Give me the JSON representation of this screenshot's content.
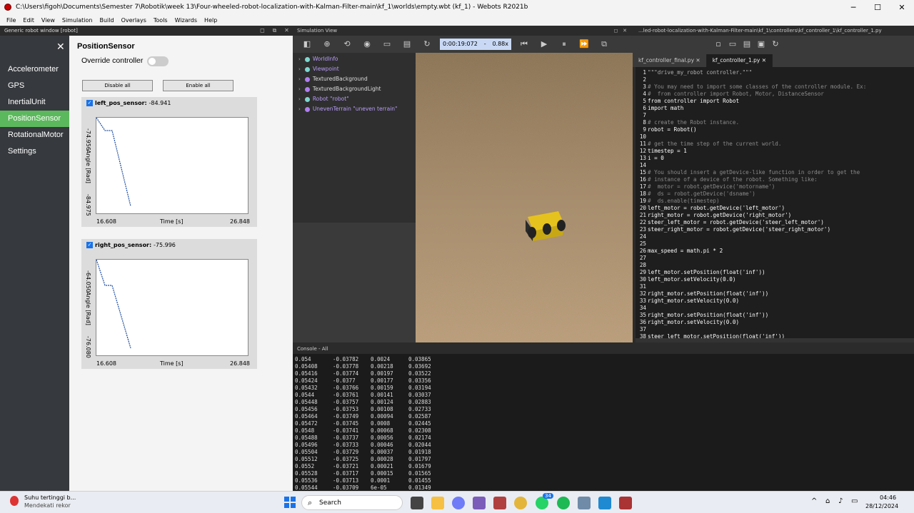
{
  "window": {
    "title": "C:\\Users\\figoh\\Documents\\Semester 7\\Robotik\\week 13\\Four-wheeled-robot-localization-with-Kalman-Filter-main\\kf_1\\worlds\\empty.wbt (kf_1) - Webots R2021b",
    "minimize": "─",
    "maximize": "☐",
    "close": "✕"
  },
  "menu": [
    "File",
    "Edit",
    "View",
    "Simulation",
    "Build",
    "Overlays",
    "Tools",
    "Wizards",
    "Help"
  ],
  "robot_window": {
    "title": "Generic robot window [robot]",
    "close": "✕",
    "sidebar": [
      "Accelerometer",
      "GPS",
      "InertialUnit",
      "PositionSensor",
      "RotationalMotor",
      "Settings"
    ],
    "active": "PositionSensor",
    "heading": "PositionSensor",
    "override": "Override controller",
    "disable_all": "Disable all",
    "enable_all": "Enable all",
    "plots": [
      {
        "label": "left_pos_sensor:",
        "value": "-84.941",
        "ymax": "-74.956",
        "ymin": "-84.975",
        "ylabel": "Angle [Rad]",
        "xmin": "16.608",
        "xmax": "26.848",
        "xlabel": "Time [s]"
      },
      {
        "label": "right_pos_sensor:",
        "value": "-75.996",
        "ymax": "-64.050",
        "ymin": "-76.080",
        "ylabel": "Angle [Rad]",
        "xmin": "16.608",
        "xmax": "26.848",
        "xlabel": "Time [s]"
      }
    ]
  },
  "sim": {
    "title": "Simulation View",
    "time": "0:00:19:072",
    "sep": "-",
    "speed": "0.88x",
    "scene_tree": [
      {
        "label": "WorldInfo",
        "color": "#7fd6d0"
      },
      {
        "label": "Viewpoint",
        "color": "#7fd6d0"
      },
      {
        "label": "TexturedBackground",
        "color": "#b07ef0"
      },
      {
        "label": "TexturedBackgroundLight",
        "color": "#b07ef0"
      },
      {
        "label": "Robot \"robot\"",
        "color": "#7fd6d0"
      },
      {
        "label": "UnevenTerrain \"uneven terrain\"",
        "color": "#b07ef0"
      }
    ]
  },
  "editor": {
    "title": "...led-robot-localization-with-Kalman-Filter-main\\kf_1\\controllers\\kf_controller_1\\kf_controller_1.py",
    "tabs": [
      "kf_controller_final.py",
      "kf_controller_1.py"
    ],
    "lines": [
      {
        "n": "1",
        "t": "\"\"\"drive_my_robot controller.\"\"\"",
        "c": "#b0b0b0"
      },
      {
        "n": "2",
        "t": "",
        "c": "#fff"
      },
      {
        "n": "3",
        "t": "# You may need to import some classes of the controller module. Ex:",
        "c": "#8a8a8a"
      },
      {
        "n": "4",
        "t": "#  from controller import Robot, Motor, DistanceSensor",
        "c": "#8a8a8a"
      },
      {
        "n": "5",
        "t": "from controller import Robot",
        "c": "#fff"
      },
      {
        "n": "6",
        "t": "import math",
        "c": "#fff"
      },
      {
        "n": "7",
        "t": "",
        "c": "#fff"
      },
      {
        "n": "8",
        "t": "# create the Robot instance.",
        "c": "#8a8a8a"
      },
      {
        "n": "9",
        "t": "robot = Robot()",
        "c": "#fff"
      },
      {
        "n": "10",
        "t": "",
        "c": "#fff"
      },
      {
        "n": "11",
        "t": "# get the time step of the current world.",
        "c": "#8a8a8a"
      },
      {
        "n": "12",
        "t": "timestep = 1",
        "c": "#fff"
      },
      {
        "n": "13",
        "t": "i = 0",
        "c": "#fff"
      },
      {
        "n": "14",
        "t": "",
        "c": "#fff"
      },
      {
        "n": "15",
        "t": "# You should insert a getDevice-like function in order to get the",
        "c": "#8a8a8a"
      },
      {
        "n": "16",
        "t": "# instance of a device of the robot. Something like:",
        "c": "#8a8a8a"
      },
      {
        "n": "17",
        "t": "#  motor = robot.getDevice('motorname')",
        "c": "#8a8a8a"
      },
      {
        "n": "18",
        "t": "#  ds = robot.getDevice('dsname')",
        "c": "#8a8a8a"
      },
      {
        "n": "19",
        "t": "#  ds.enable(timestep)",
        "c": "#8a8a8a"
      },
      {
        "n": "20",
        "t": "left_motor = robot.getDevice('left_motor')",
        "c": "#fff"
      },
      {
        "n": "21",
        "t": "right_motor = robot.getDevice('right_motor')",
        "c": "#fff"
      },
      {
        "n": "22",
        "t": "steer_left_motor = robot.getDevice('steer_left_motor')",
        "c": "#fff"
      },
      {
        "n": "23",
        "t": "steer_right_motor = robot.getDevice('steer_right_motor')",
        "c": "#fff"
      },
      {
        "n": "24",
        "t": "",
        "c": "#fff"
      },
      {
        "n": "25",
        "t": "",
        "c": "#fff"
      },
      {
        "n": "26",
        "t": "max_speed = math.pi * 2",
        "c": "#fff"
      },
      {
        "n": "27",
        "t": "",
        "c": "#fff"
      },
      {
        "n": "28",
        "t": "",
        "c": "#fff"
      },
      {
        "n": "29",
        "t": "left_motor.setPosition(float('inf'))",
        "c": "#fff"
      },
      {
        "n": "30",
        "t": "left_motor.setVelocity(0.0)",
        "c": "#fff"
      },
      {
        "n": "31",
        "t": "",
        "c": "#fff"
      },
      {
        "n": "32",
        "t": "right_motor.setPosition(float('inf'))",
        "c": "#fff"
      },
      {
        "n": "33",
        "t": "right_motor.setVelocity(0.0)",
        "c": "#fff"
      },
      {
        "n": "34",
        "t": "",
        "c": "#fff"
      },
      {
        "n": "35",
        "t": "right_motor.setPosition(float('inf'))",
        "c": "#fff"
      },
      {
        "n": "36",
        "t": "right_motor.setVelocity(0.0)",
        "c": "#fff"
      },
      {
        "n": "37",
        "t": "",
        "c": "#fff"
      },
      {
        "n": "38",
        "t": "steer_left_motor.setPosition(float('inf'))",
        "c": "#fff"
      }
    ]
  },
  "console": {
    "title": "Console - All",
    "rows": [
      [
        "0.054",
        "-0.03782",
        "0.0024",
        "0.03865"
      ],
      [
        "0.05408",
        "-0.03778",
        "0.00218",
        "0.03692"
      ],
      [
        "0.05416",
        "-0.03774",
        "0.00197",
        "0.03522"
      ],
      [
        "0.05424",
        "-0.0377",
        "0.00177",
        "0.03356"
      ],
      [
        "0.05432",
        "-0.03766",
        "0.00159",
        "0.03194"
      ],
      [
        "0.0544",
        "-0.03761",
        "0.00141",
        "0.03037"
      ],
      [
        "0.05448",
        "-0.03757",
        "0.00124",
        "0.02883"
      ],
      [
        "0.05456",
        "-0.03753",
        "0.00108",
        "0.02733"
      ],
      [
        "0.05464",
        "-0.03749",
        "0.00094",
        "0.02587"
      ],
      [
        "0.05472",
        "-0.03745",
        "0.0008",
        "0.02445"
      ],
      [
        "0.0548",
        "-0.03741",
        "0.00068",
        "0.02308"
      ],
      [
        "0.05488",
        "-0.03737",
        "0.00056",
        "0.02174"
      ],
      [
        "0.05496",
        "-0.03733",
        "0.00046",
        "0.02044"
      ],
      [
        "0.05504",
        "-0.03729",
        "0.00037",
        "0.01918"
      ],
      [
        "0.05512",
        "-0.03725",
        "0.00028",
        "0.01797"
      ],
      [
        "0.0552",
        "-0.03721",
        "0.00021",
        "0.01679"
      ],
      [
        "0.05528",
        "-0.03717",
        "0.00015",
        "0.01565"
      ],
      [
        "0.05536",
        "-0.03713",
        "0.0001",
        "0.01455"
      ],
      [
        "0.05544",
        "-0.03709",
        "6e-05",
        "0.01349"
      ]
    ]
  },
  "taskbar": {
    "weather_title": "Suhu tertinggi b...",
    "weather_sub": "Mendekati rekor",
    "search": "Search",
    "time": "04:46",
    "date": "28/12/2024",
    "badge": "34"
  }
}
